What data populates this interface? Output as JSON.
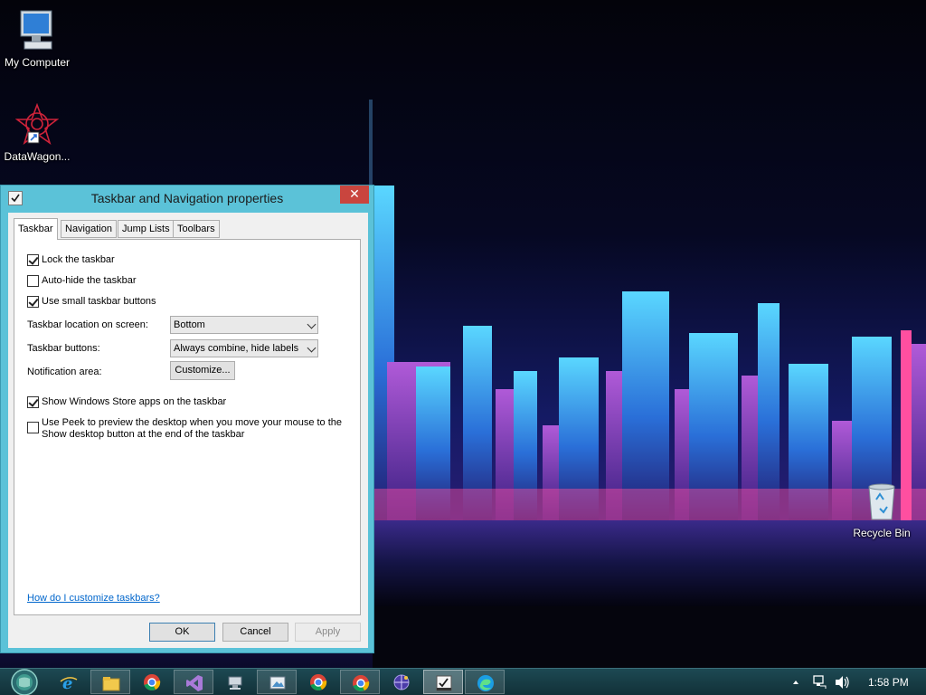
{
  "desktop": {
    "icons": [
      {
        "label": "My Computer",
        "icon": "computer-icon"
      },
      {
        "label": "DataWagon...",
        "icon": "datawagon-icon"
      },
      {
        "label": "Recycle Bin",
        "icon": "recycle-bin-icon"
      }
    ]
  },
  "dialog": {
    "title": "Taskbar and Navigation properties",
    "close_label": "✕",
    "tabs": [
      {
        "label": "Taskbar",
        "active": true
      },
      {
        "label": "Navigation",
        "active": false
      },
      {
        "label": "Jump Lists",
        "active": false
      },
      {
        "label": "Toolbars",
        "active": false
      }
    ],
    "checkboxes": {
      "lock": {
        "label": "Lock the taskbar",
        "checked": true
      },
      "autohide": {
        "label": "Auto-hide the taskbar",
        "checked": false
      },
      "small": {
        "label": "Use small taskbar buttons",
        "checked": true
      },
      "store": {
        "label": "Show Windows Store apps on the taskbar",
        "checked": true
      },
      "peek": {
        "label_line1": "Use Peek to preview the desktop when you move your mouse to the",
        "label_line2": "Show desktop button at the end of the taskbar",
        "checked": false
      }
    },
    "location": {
      "label": "Taskbar location on screen:",
      "value": "Bottom"
    },
    "buttons_setting": {
      "label": "Taskbar buttons:",
      "value": "Always combine, hide labels"
    },
    "notification": {
      "label": "Notification area:",
      "button": "Customize..."
    },
    "help_link": "How do I customize taskbars?",
    "ok": "OK",
    "cancel": "Cancel",
    "apply": "Apply"
  },
  "taskbar": {
    "items": [
      {
        "icon": "internet-explorer-icon",
        "state": "normal"
      },
      {
        "icon": "file-explorer-icon",
        "state": "pinned"
      },
      {
        "icon": "chrome-icon",
        "state": "normal"
      },
      {
        "icon": "visual-studio-icon",
        "state": "pinned"
      },
      {
        "icon": "network-app-icon",
        "state": "normal"
      },
      {
        "icon": "image-viewer-icon",
        "state": "pinned"
      },
      {
        "icon": "chrome-icon",
        "state": "normal"
      },
      {
        "icon": "chrome-icon",
        "state": "pinned"
      },
      {
        "icon": "globe-app-icon",
        "state": "normal"
      },
      {
        "icon": "taskbar-properties-icon",
        "state": "active"
      },
      {
        "icon": "edge-icon",
        "state": "pinned"
      }
    ],
    "clock": "1:58 PM"
  },
  "colors": {
    "title_bar": "#5bc2d8",
    "close_button": "#c9453e",
    "taskbar": "#1d4953",
    "link": "#0066cc"
  }
}
